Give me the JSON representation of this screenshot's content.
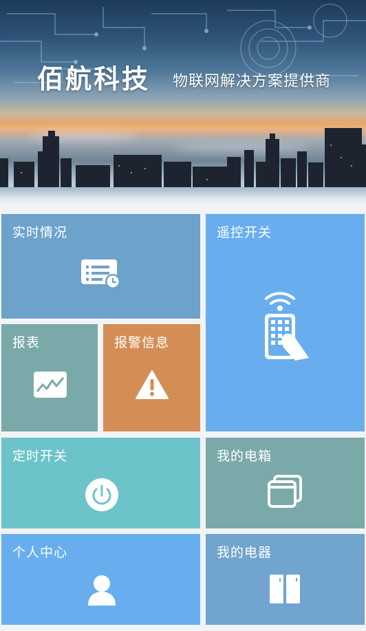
{
  "banner": {
    "brand": "佰航科技",
    "slogan": "物联网解决方案提供商"
  },
  "tiles": [
    {
      "label": "实时情况",
      "icon": "list-clock-icon",
      "color": "#6da2cb"
    },
    {
      "label": "遥控开关",
      "icon": "remote-control-icon",
      "color": "#68aeee"
    },
    {
      "label": "报表",
      "icon": "line-chart-icon",
      "color": "#7aa9a9"
    },
    {
      "label": "报警信息",
      "icon": "warning-icon",
      "color": "#d48e55"
    },
    {
      "label": "定时开关",
      "icon": "power-icon",
      "color": "#6cc4ca"
    },
    {
      "label": "我的电箱",
      "icon": "windows-stack-icon",
      "color": "#7aa9a9"
    },
    {
      "label": "个人中心",
      "icon": "user-icon",
      "color": "#68aeee"
    },
    {
      "label": "我的电器",
      "icon": "cabinet-icon",
      "color": "#71a4ce"
    }
  ]
}
